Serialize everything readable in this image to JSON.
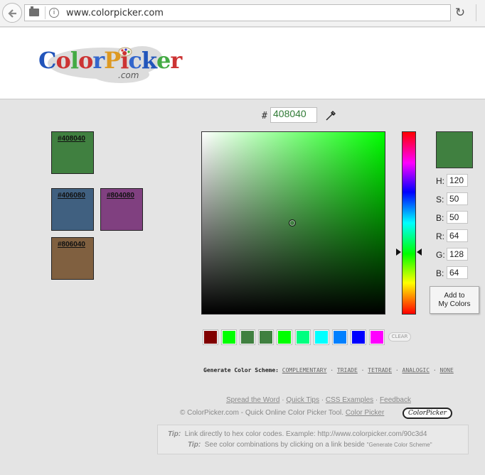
{
  "browser": {
    "url": "www.colorpicker.com",
    "info_glyph": "i",
    "reload_glyph": "↻"
  },
  "header": {
    "logo_text": [
      "C",
      "o",
      "l",
      "o",
      "r",
      "P",
      "i",
      "c",
      "k",
      "e",
      "r"
    ],
    "logo_colors": [
      "#2255bb",
      "#cc3333",
      "#44aa44",
      "#cc3333",
      "#3366cc",
      "#dd9922",
      "#cc3333",
      "#3366cc",
      "#2255bb",
      "#44aa44",
      "#cc3333"
    ],
    "logo_sub": ".com"
  },
  "picker": {
    "hash_symbol": "#",
    "hex_value": "408040",
    "current_color": "#408040",
    "values": [
      {
        "label": "H:",
        "value": "120"
      },
      {
        "label": "S:",
        "value": "50"
      },
      {
        "label": "B:",
        "value": "50"
      },
      {
        "label": "R:",
        "value": "64"
      },
      {
        "label": "G:",
        "value": "128"
      },
      {
        "label": "B:",
        "value": "64"
      }
    ],
    "add_button": [
      "Add to",
      "My Colors"
    ]
  },
  "saved_colors": [
    {
      "label": "#408040",
      "color": "#408040"
    },
    {
      "label": "#406080",
      "color": "#406080"
    },
    {
      "label": "#804080",
      "color": "#804080"
    },
    {
      "label": "#806040",
      "color": "#806040"
    }
  ],
  "swatches": [
    "#800000",
    "#00ff00",
    "#408040",
    "#408040",
    "#00ff00",
    "#00ff80",
    "#00ffff",
    "#0080ff",
    "#0000ff",
    "#ff00ff"
  ],
  "clear_label": "CLEAR",
  "scheme": {
    "label": "Generate Color Scheme:",
    "options": [
      "COMPLEMENTARY",
      "TRIADE",
      "TETRADE",
      "ANALOGIC",
      "NONE"
    ],
    "separator": "·"
  },
  "footer": {
    "links": [
      "Spread the Word",
      "Quick Tips",
      "CSS Examples",
      "Feedback"
    ],
    "separator": " · ",
    "copyright": "© ColorPicker.com - Quick Online Color Picker Tool.",
    "copyright_link": "Color Picker",
    "badge": "ColorPicker"
  },
  "tips": [
    {
      "label": "Tip:",
      "text": "Link directly to hex color codes.   Example: http://www.colorpicker.com/90c3d4"
    },
    {
      "label": "Tip:",
      "text": "See color combinations by clicking on a link beside",
      "small": "\"Generate Color Scheme\""
    }
  ]
}
